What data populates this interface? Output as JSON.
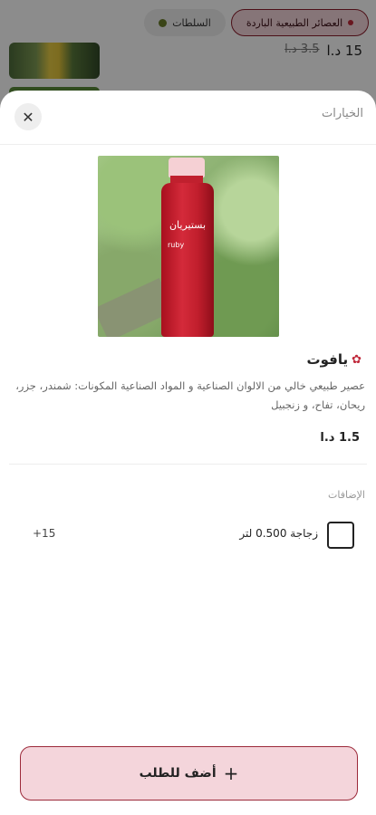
{
  "background": {
    "tabs": [
      {
        "label": "العصائر الطبيعية الباردة"
      },
      {
        "label": "السلطات"
      }
    ],
    "price": "15 د.ا",
    "old_price": "3.5 د.ا"
  },
  "sheet": {
    "title": "الخيارات",
    "product": {
      "name": "يافوت",
      "description": "عصير طبيعي خالي من الالوان الصناعية و المواد الصناعية المكونات: شمندر، جزر، ريحان، تفاح، و زنجبيل",
      "price": "1.5 د.ا",
      "bottle_script": "بستيريان",
      "bottle_label": "ruby"
    },
    "addons_title": "الإضافات",
    "addons": [
      {
        "label": "زجاجة 0.500 لتر",
        "price": "+15"
      }
    ],
    "add_button_label": "أضف للطلب"
  },
  "colors": {
    "accent": "#9c2a3a",
    "accent_light": "#f4d5db"
  }
}
